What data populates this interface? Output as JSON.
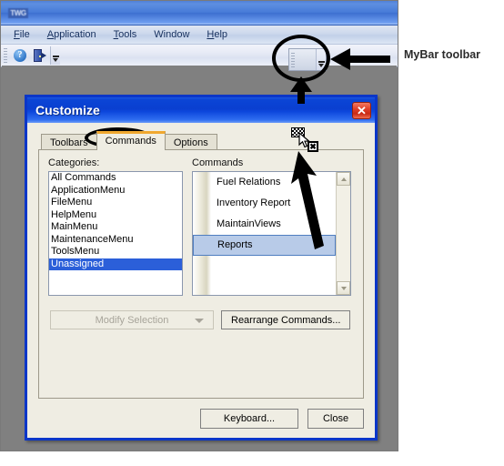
{
  "app": {
    "title_logo": "TWG",
    "menus": [
      {
        "label": "File",
        "accel": "F"
      },
      {
        "label": "Application",
        "accel": "A"
      },
      {
        "label": "Tools",
        "accel": "T"
      },
      {
        "label": "Window",
        "accel": "W"
      },
      {
        "label": "Help",
        "accel": "H"
      }
    ],
    "toolbar": {
      "help_icon": "help-question-icon",
      "exit_icon": "exit-door-icon",
      "overflow_icon": "toolbar-overflow-chevron"
    },
    "mybar": {
      "name": "MyBar",
      "overflow_icon": "toolbar-overflow-chevron"
    }
  },
  "annotation": {
    "text": "MyBar toolbar",
    "arrow_left_icon": "left-pointing-arrow",
    "arrow_up_icon": "up-pointing-arrow",
    "circle_icon": "ellipse-highlight",
    "drag_cursor_icon": "drag-no-drop-cursor"
  },
  "dialog": {
    "title": "Customize",
    "close_label": "✕",
    "close_icon": "close-x-icon",
    "tabs": [
      {
        "label": "Toolbars",
        "active": false
      },
      {
        "label": "Commands",
        "active": true
      },
      {
        "label": "Options",
        "active": false
      }
    ],
    "categories": {
      "label": "Categories:",
      "items": [
        {
          "label": "All Commands",
          "selected": false
        },
        {
          "label": "ApplicationMenu",
          "selected": false
        },
        {
          "label": "FileMenu",
          "selected": false
        },
        {
          "label": "HelpMenu",
          "selected": false
        },
        {
          "label": "MainMenu",
          "selected": false
        },
        {
          "label": "MaintenanceMenu",
          "selected": false
        },
        {
          "label": "ToolsMenu",
          "selected": false
        },
        {
          "label": "Unassigned",
          "selected": true
        }
      ]
    },
    "commands": {
      "label": "Commands",
      "items": [
        {
          "label": "Fuel Relations",
          "selected": false
        },
        {
          "label": "Inventory Report",
          "selected": false
        },
        {
          "label": "MaintainViews",
          "selected": false
        },
        {
          "label": "Reports",
          "selected": true
        }
      ],
      "scroll_up_icon": "scroll-up-arrow",
      "scroll_down_icon": "scroll-down-arrow"
    },
    "buttons": {
      "modify_selection": "Modify Selection",
      "modify_selection_caret_icon": "chevron-down-icon",
      "rearrange_commands": "Rearrange Commands...",
      "keyboard": "Keyboard...",
      "close": "Close"
    }
  }
}
